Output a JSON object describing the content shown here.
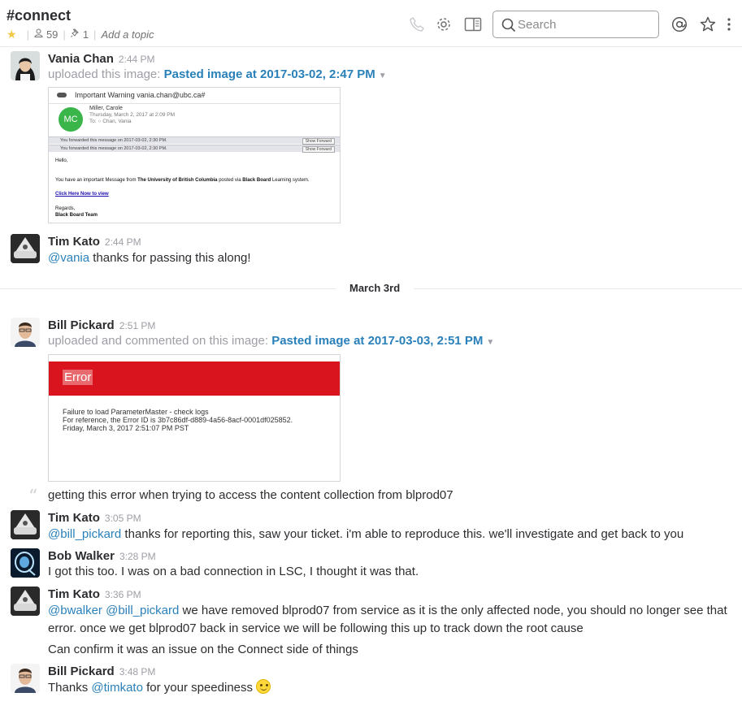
{
  "header": {
    "channel": "#connect",
    "members": "59",
    "pins": "1",
    "add_topic": "Add a topic",
    "search_placeholder": "Search",
    "icons": [
      "star-icon",
      "members-icon",
      "pin-icon",
      "call-icon",
      "gear-icon",
      "sidebar-toggle-icon",
      "search-icon",
      "mention-icon",
      "star-outline-icon",
      "more-icon"
    ]
  },
  "colors": {
    "link": "#2a80b9",
    "star": "#f2c744",
    "muted": "#9e9ea6"
  },
  "messages": [
    {
      "author": "Vania Chan",
      "time": "2:44 PM",
      "action": "uploaded this image:",
      "file": "Pasted image at 2017-03-02, 2:47 PM"
    },
    {
      "author": "Tim Kato",
      "time": "2:44 PM",
      "mention": "@vania",
      "text": " thanks for passing this along!"
    },
    {
      "author": "Bill Pickard",
      "time": "2:51 PM",
      "action": "uploaded and commented on this image:",
      "file": "Pasted image at 2017-03-03, 2:51 PM",
      "comment": "getting this error when trying to access the content collection from blprod07"
    },
    {
      "author": "Tim Kato",
      "time": "3:05 PM",
      "mention": "@bill_pickard",
      "text": " thanks for reporting this, saw your ticket. i'm able to reproduce this. we'll investigate and get back to you"
    },
    {
      "author": "Bob Walker",
      "time": "3:28 PM",
      "text": "I got this too. I was on a bad connection in LSC, I thought it was that."
    },
    {
      "author": "Tim Kato",
      "time": "3:36 PM",
      "mention1": "@bwalker",
      "mention2": "@bill_pickard",
      "text1": " we have removed blprod07 from service as it is the only affected node, you should no longer see that",
      "text2": "error. once we get blprod07 back in service we will be following this up to track down the root cause",
      "text3": "Can confirm it was an issue on the Connect side of things"
    },
    {
      "author": "Bill Pickard",
      "time": "3:48 PM",
      "prefix": "Thanks ",
      "mention": "@timkato",
      "text": " for your speediness"
    }
  ],
  "date_divider": "March 3rd",
  "email_preview": {
    "subject": "Important Warning vania.chan@ubc.ca#",
    "initials": "MC",
    "from_name": "Miller, Carole",
    "sent": "Thursday, March 2, 2017 at 2:09 PM",
    "to": "To:  ○ Chan, Vania",
    "forwarded_1": "You forwarded this message on 2017-03-02, 2:30 PM.",
    "forwarded_2": "You forwarded this message on 2017-03-02, 2:30 PM.",
    "show_forward": "Show Forward",
    "greeting": "Hello,",
    "body_pre": "You have an important Message from ",
    "body_org": "The University of British Columbia",
    "body_mid": " posted via ",
    "body_sys": "Black Board",
    "body_post": " Learning system.",
    "link": "Click Here Now to view",
    "regards": "Regards,",
    "team": "Black Board Team"
  },
  "error_preview": {
    "title": "Error",
    "line1": "Failure to load ParameterMaster - check logs",
    "line2": "For reference, the Error ID is 3b7c86df-d889-4a56-8acf-0001df025852.",
    "line3": "Friday, March 3, 2017 2:51:07 PM PST"
  }
}
